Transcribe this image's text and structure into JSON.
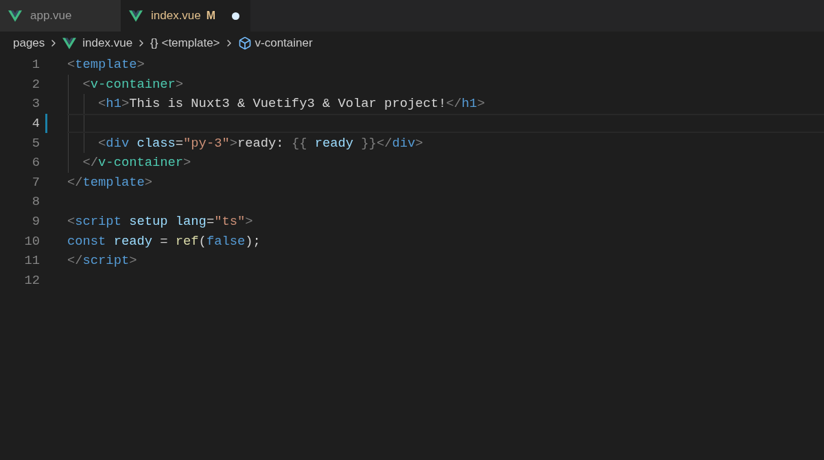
{
  "tabs": [
    {
      "label": "app.vue",
      "selected": false,
      "modified": false
    },
    {
      "label": "index.vue",
      "selected": true,
      "modified": true,
      "badge": "M"
    }
  ],
  "breadcrumb": [
    {
      "kind": "folder",
      "label": "pages"
    },
    {
      "kind": "file",
      "label": "index.vue"
    },
    {
      "kind": "braces",
      "symbol": "{}",
      "label": "<template>"
    },
    {
      "kind": "component",
      "label": "v-container"
    }
  ],
  "lines": [
    {
      "number": "1",
      "current": false,
      "modified": false,
      "tokens": [
        {
          "kind": "punct",
          "text": "<"
        },
        {
          "kind": "tag",
          "text": "template"
        },
        {
          "kind": "punct",
          "text": ">"
        }
      ]
    },
    {
      "number": "2",
      "current": false,
      "modified": false,
      "tokens": [
        {
          "kind": "punct",
          "text": "  <"
        },
        {
          "kind": "component",
          "text": "v-container"
        },
        {
          "kind": "punct",
          "text": ">"
        }
      ]
    },
    {
      "number": "3",
      "current": false,
      "modified": false,
      "tokens": [
        {
          "kind": "punct",
          "text": "    <"
        },
        {
          "kind": "tag",
          "text": "h1"
        },
        {
          "kind": "punct",
          "text": ">"
        },
        {
          "kind": "plain",
          "text": "This is Nuxt3 & Vuetify3 & Volar project!"
        },
        {
          "kind": "punct",
          "text": "</"
        },
        {
          "kind": "tag",
          "text": "h1"
        },
        {
          "kind": "punct",
          "text": ">"
        }
      ]
    },
    {
      "number": "4",
      "current": true,
      "modified": true
    },
    {
      "number": "5",
      "current": false,
      "modified": false,
      "tokens": [
        {
          "kind": "punct",
          "text": "    <"
        },
        {
          "kind": "tag",
          "text": "div"
        },
        {
          "kind": "attr",
          "text": " class"
        },
        {
          "kind": "plain",
          "text": "="
        },
        {
          "kind": "string",
          "text": "\"py-3\""
        },
        {
          "kind": "punct",
          "text": ">"
        },
        {
          "kind": "plain",
          "text": "ready: "
        },
        {
          "kind": "punct",
          "text": "{{"
        },
        {
          "kind": "attr",
          "text": " ready "
        },
        {
          "kind": "punct",
          "text": "}}"
        },
        {
          "kind": "punct",
          "text": "</"
        },
        {
          "kind": "tag",
          "text": "div"
        },
        {
          "kind": "punct",
          "text": ">"
        }
      ]
    },
    {
      "number": "6",
      "current": false,
      "modified": false,
      "tokens": [
        {
          "kind": "punct",
          "text": "  </"
        },
        {
          "kind": "component",
          "text": "v-container"
        },
        {
          "kind": "punct",
          "text": ">"
        }
      ]
    },
    {
      "number": "7",
      "current": false,
      "modified": false,
      "tokens": [
        {
          "kind": "punct",
          "text": "</"
        },
        {
          "kind": "tag",
          "text": "template"
        },
        {
          "kind": "punct",
          "text": ">"
        }
      ]
    },
    {
      "number": "8",
      "current": false,
      "modified": false
    },
    {
      "number": "9",
      "current": false,
      "modified": false,
      "tokens": [
        {
          "kind": "punct",
          "text": "<"
        },
        {
          "kind": "tag",
          "text": "script"
        },
        {
          "kind": "attr",
          "text": " setup lang"
        },
        {
          "kind": "plain",
          "text": "="
        },
        {
          "kind": "string",
          "text": "\"ts\""
        },
        {
          "kind": "punct",
          "text": ">"
        }
      ]
    },
    {
      "number": "10",
      "current": false,
      "modified": false,
      "tokens": [
        {
          "kind": "keyword",
          "text": "const"
        },
        {
          "kind": "attr",
          "text": " ready"
        },
        {
          "kind": "plain",
          "text": " = "
        },
        {
          "kind": "function",
          "text": "ref"
        },
        {
          "kind": "plain",
          "text": "("
        },
        {
          "kind": "keyword",
          "text": "false"
        },
        {
          "kind": "plain",
          "text": ");"
        }
      ]
    },
    {
      "number": "11",
      "current": false,
      "modified": false,
      "tokens": [
        {
          "kind": "punct",
          "text": "</"
        },
        {
          "kind": "tag",
          "text": "script"
        },
        {
          "kind": "punct",
          "text": ">"
        }
      ]
    },
    {
      "number": "12",
      "current": false,
      "modified": false
    }
  ]
}
